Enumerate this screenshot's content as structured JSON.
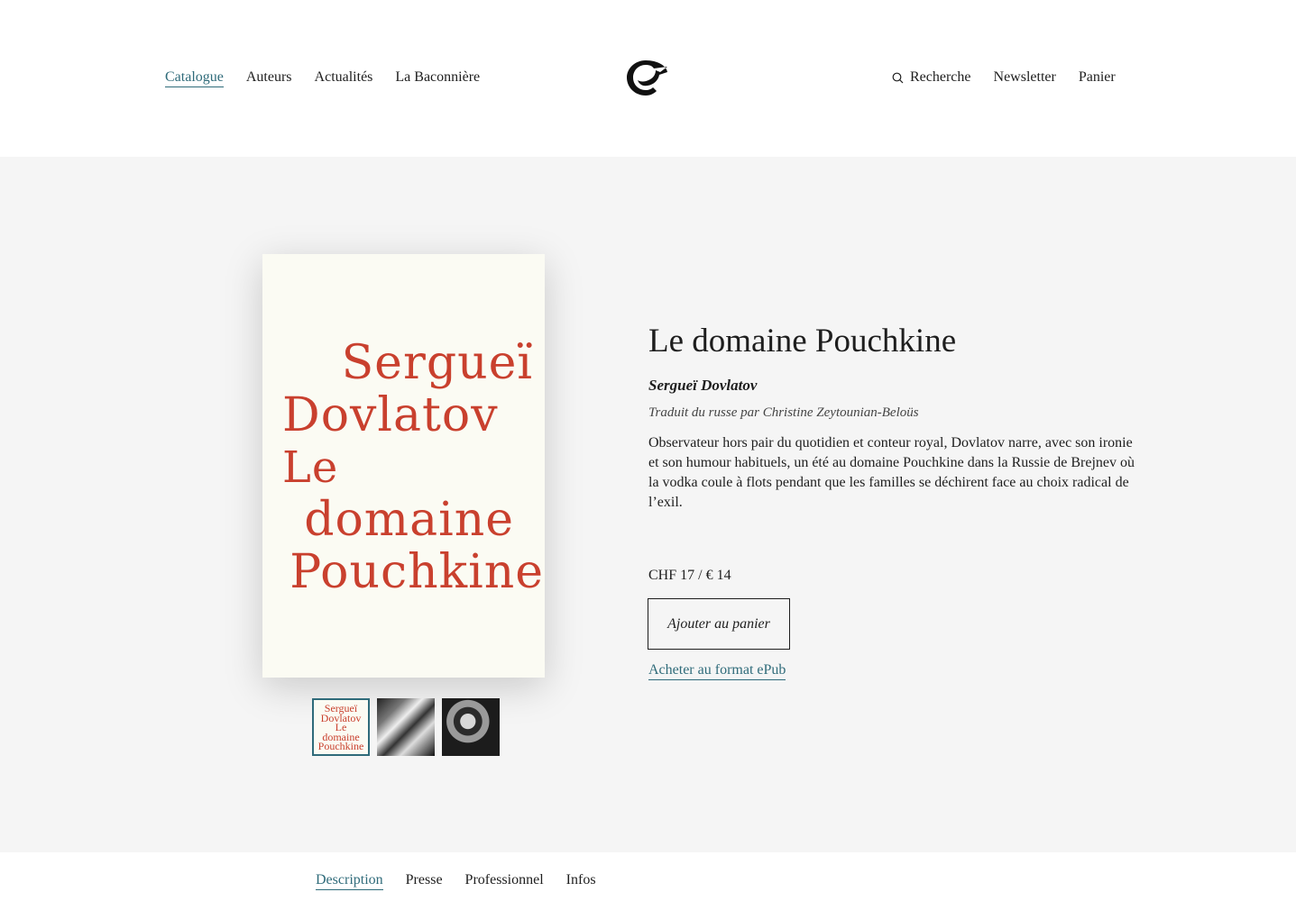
{
  "header": {
    "nav_left": [
      {
        "label": "Catalogue",
        "active": true
      },
      {
        "label": "Auteurs",
        "active": false
      },
      {
        "label": "Actualités",
        "active": false
      },
      {
        "label": "La Baconnière",
        "active": false
      }
    ],
    "nav_right": {
      "search": "Recherche",
      "newsletter": "Newsletter",
      "cart": "Panier"
    },
    "logo_icon": "publisher-bird-logo"
  },
  "product": {
    "cover": {
      "author_line1": "Sergueï",
      "author_line2": "Dovlatov",
      "title_line1": "Le",
      "title_line2": "domaine",
      "title_line3": "Pouchkine"
    },
    "thumbnails": [
      "cover",
      "photo-crowd",
      "photo-portrait"
    ],
    "title": "Le domaine Pouchkine",
    "author": "Sergueï Dovlatov",
    "translator": "Traduit du russe par Christine Zeytounian-Beloüs",
    "description": "Observateur hors pair du quotidien et conteur royal, Dovlatov narre, avec son ironie et son humour habituels, un été au domaine Pouchkine dans la Russie de Brejnev où la vodka coule à flots pendant que les familles se déchirent face au choix radical de l’exil.",
    "price": "CHF 17 / € 14",
    "add_to_cart": "Ajouter au panier",
    "epub_link": "Acheter au format ePub"
  },
  "tabs": [
    {
      "label": "Description",
      "active": true
    },
    {
      "label": "Presse",
      "active": false
    },
    {
      "label": "Professionnel",
      "active": false
    },
    {
      "label": "Infos",
      "active": false
    }
  ],
  "colors": {
    "accent": "#2f6b7a",
    "cover_text": "#c9402e",
    "main_bg": "#f5f5f5"
  }
}
